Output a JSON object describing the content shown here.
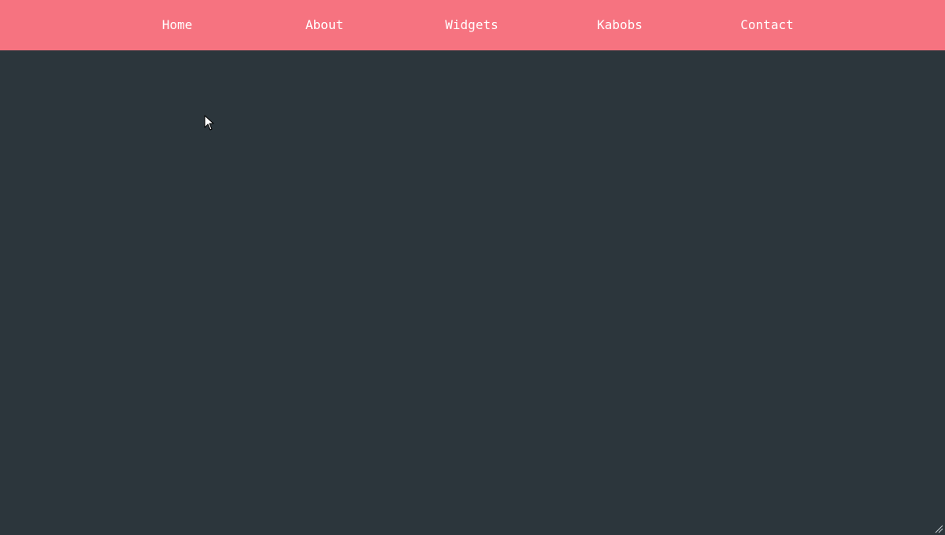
{
  "nav": {
    "items": [
      {
        "label": "Home"
      },
      {
        "label": "About"
      },
      {
        "label": "Widgets"
      },
      {
        "label": "Kabobs"
      },
      {
        "label": "Contact"
      }
    ]
  },
  "colors": {
    "navbar_bg": "#f67380",
    "page_bg": "#2c363c",
    "nav_text": "#ffffff"
  },
  "icons": {
    "cursor": "mouse-pointer-icon",
    "resize": "resize-grip-icon"
  }
}
